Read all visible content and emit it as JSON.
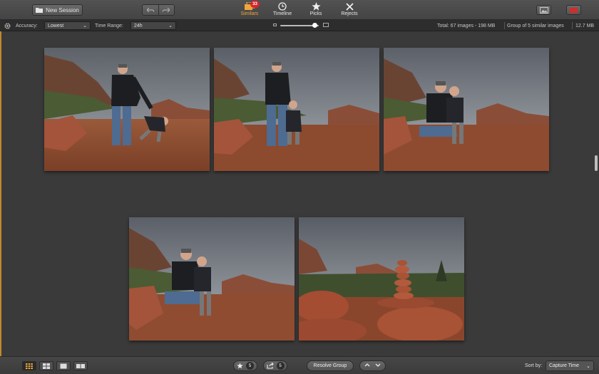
{
  "toolbar": {
    "new_session_label": "New Session",
    "tabs": [
      {
        "label": "Similars",
        "icon": "similars-stack-icon",
        "badge": "33",
        "active": true
      },
      {
        "label": "Timeline",
        "icon": "clock-icon"
      },
      {
        "label": "Picks",
        "icon": "star-icon"
      },
      {
        "label": "Rejects",
        "icon": "x-icon"
      }
    ]
  },
  "options": {
    "accuracy_label": "Accuracy:",
    "accuracy_value": "Lowest",
    "time_range_label": "Time Range:",
    "time_range_value": "24h",
    "thumbnail_size_fraction": 0.9,
    "total_label": "Total: 67 images - 198 MB",
    "group_label": "Group of 5 similar images",
    "group_size": "12.7 MB"
  },
  "photos": [
    {
      "name": "photo-1",
      "scene": "man-and-boy-bending"
    },
    {
      "name": "photo-2",
      "scene": "man-and-boy-standing"
    },
    {
      "name": "photo-3",
      "scene": "man-kneeling-with-boy"
    },
    {
      "name": "photo-4",
      "scene": "man-kneeling-with-boy-alt"
    },
    {
      "name": "photo-5",
      "scene": "rock-cairn"
    }
  ],
  "bottom": {
    "picks_count": "5",
    "share_count": "5",
    "resolve_label": "Resolve Group",
    "sort_label": "Sort by:",
    "sort_value": "Capture Time"
  },
  "colors": {
    "accent": "#f0a63a",
    "badge": "#d7262b",
    "background": "#3a3a3a"
  }
}
